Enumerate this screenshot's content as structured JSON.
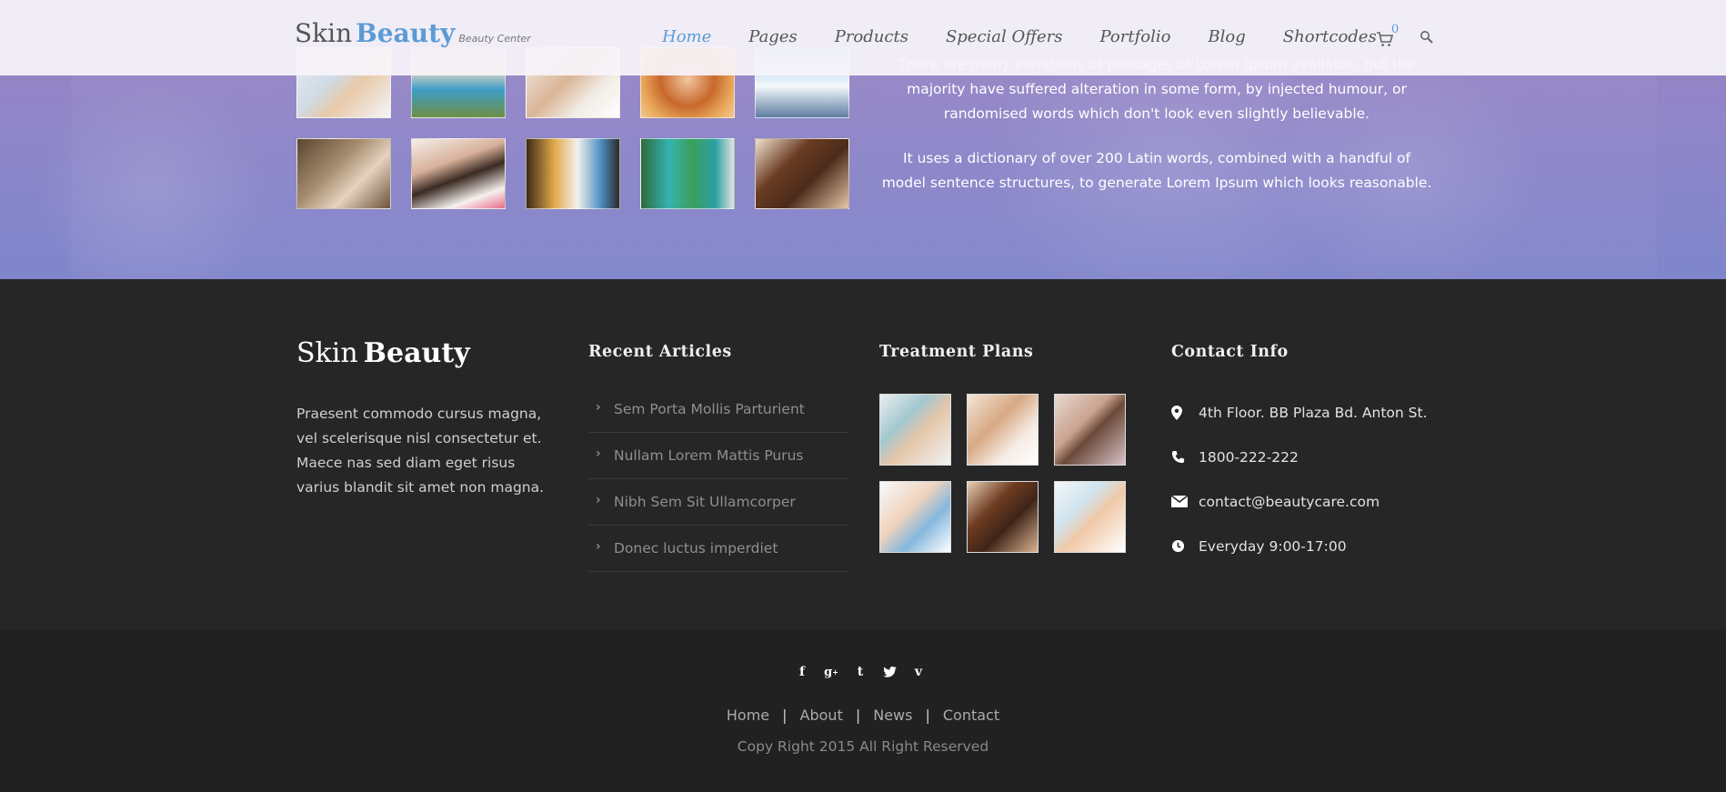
{
  "header": {
    "logo_skin": "Skin",
    "logo_beauty": "Beauty",
    "logo_tagline": "Beauty Center",
    "nav": [
      "Home",
      "Pages",
      "Products",
      "Special Offers",
      "Portfolio",
      "Blog",
      "Shortcodes"
    ],
    "active_nav": "Home",
    "cart_count": "0",
    "cart_icon": "cart-icon",
    "search_icon": "search-icon"
  },
  "hero": {
    "paragraph_1": "There are many variations of passages of Lorem Ipsum available, but the majority have suffered alteration in some form, by injected humour, or randomised words which don't look even slightly believable.",
    "paragraph_2": "It uses a dictionary of over 200 Latin words, combined with a handful of model sentence structures, to generate Lorem Ipsum which looks reasonable.",
    "gallery_count": 10
  },
  "footer": {
    "logo_skin": "Skin",
    "logo_beauty": "Beauty",
    "about": "Praesent commodo cursus magna, vel scelerisque nisl consectetur et. Maece nas sed diam eget risus varius blandit sit amet non magna.",
    "recent_articles_title": "Recent Articles",
    "articles": [
      "Sem Porta Mollis Parturient",
      "Nullam Lorem Mattis Purus",
      "Nibh Sem Sit Ullamcorper",
      "Donec luctus imperdiet"
    ],
    "treatment_plans_title": "Treatment Plans",
    "contact_title": "Contact Info",
    "contact": {
      "address": "4th Floor. BB Plaza Bd. Anton St.",
      "phone": "1800-222-222",
      "email": "contact@beautycare.com",
      "hours": "Everyday 9:00-17:00"
    }
  },
  "bottom": {
    "social_icons": [
      "facebook-icon",
      "google-plus-icon",
      "tumblr-icon",
      "twitter-icon",
      "vimeo-icon"
    ],
    "links": [
      "Home",
      "About",
      "News",
      "Contact"
    ],
    "copyright": "Copy Right 2015 All Right Reserved"
  },
  "colors": {
    "accent": "#5b9bd5",
    "footer_bg": "#262626",
    "footer_bottom_bg": "#212121"
  }
}
